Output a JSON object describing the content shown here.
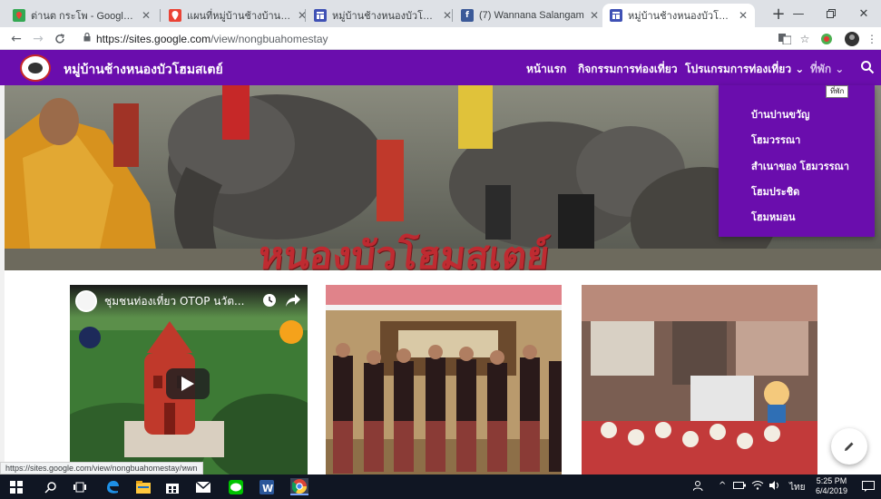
{
  "browser": {
    "tabs": [
      {
        "title": "ต่านต กระโพ - Google Maps",
        "favicon": "google-maps-icon",
        "color": "#34a853"
      },
      {
        "title": "แผนที่หมู่บ้านช้างบ้านหนองบัว",
        "favicon": "map-pin-icon",
        "color": "#ea4335"
      },
      {
        "title": "หมู่บ้านช้างหนองบัวโฮมสเตย์",
        "favicon": "google-sites-icon",
        "color": "#3f51b5"
      },
      {
        "title": "(7) Wannana Salangam",
        "favicon": "facebook-icon",
        "color": "#3b5998"
      },
      {
        "title": "หมู่บ้านช้างหนองบัวโฮมสเตย์",
        "favicon": "google-sites-icon",
        "color": "#3f51b5",
        "active": true
      }
    ],
    "new_tab": "+",
    "address": {
      "url_host": "https://sites.google.com",
      "url_path": "/view/nongbuahomestay"
    }
  },
  "site": {
    "title": "หมู่บ้านช้างหนองบัวโฮมสเตย์",
    "brand_color": "#6a0dad",
    "nav": [
      {
        "label": "หน้าแรก",
        "active": true
      },
      {
        "label": "กิจกรรมการท่องเที่ยว"
      },
      {
        "label": "โปรแกรมการท่องเที่ยว ⌄"
      },
      {
        "label": "ที่พัก ⌄",
        "dim": true
      }
    ],
    "hero_overlay_text": "หนองบัวโฮมสเตย์",
    "dropdown": {
      "tooltip": "ที่พัก",
      "items": [
        "บ้านปานขวัญ",
        "โฮมวรรณา",
        "สำเนาของ โฮมวรรณา",
        "โฮมประชิด",
        "โฮมหมอน"
      ]
    },
    "video": {
      "title": "ชุมชนท่องเที่ยว OTOP นวัต...",
      "badge": "OTOP"
    },
    "status_url": "https://sites.google.com/view/nongbuahomestay/หwn"
  },
  "taskbar": {
    "time": "5:25 PM",
    "date": "6/4/2019",
    "lang": "ไทย"
  }
}
